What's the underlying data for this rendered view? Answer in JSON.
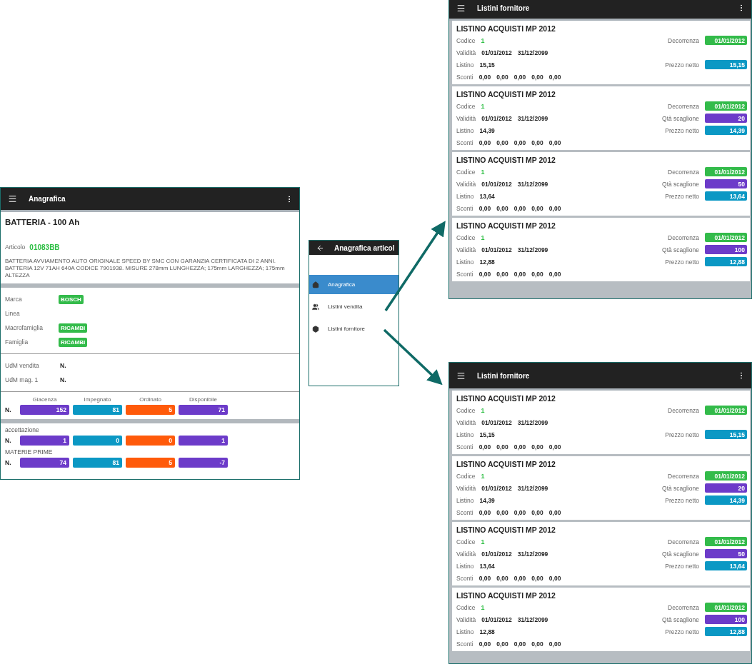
{
  "anagrafica_screen": {
    "title": "Anagrafica",
    "heading": "BATTERIA - 100 Ah",
    "articolo": {
      "label": "Articolo",
      "value": "01083BB"
    },
    "description": "BATTERIA AVVIAMENTO AUTO ORIGINALE SPEED BY SMC CON GARANZIA CERTIFICATA DI 2 ANNI. BATTERIA 12V 71AH 640A CODICE 7901938. MISURE 278mm LUNGHEZZA; 175mm LARGHEZZA; 175mm ALTEZZA",
    "attributes": [
      {
        "label": "Marca",
        "tag": "BOSCH"
      },
      {
        "label": "Linea"
      },
      {
        "label": "Macrofamiglia",
        "tag": "RICAMBI"
      },
      {
        "label": "Famiglia",
        "tag": "RICAMBI"
      }
    ],
    "units": [
      {
        "label": "UdM vendita",
        "value": "N."
      },
      {
        "label": "UdM mag. 1",
        "value": "N."
      }
    ],
    "stock_columns": [
      {
        "label": "Giacenza",
        "color": "#6c3bc9"
      },
      {
        "label": "Impegnato",
        "color": "#0b98c4"
      },
      {
        "label": "Ordinato",
        "color": "#ff5a0a"
      },
      {
        "label": "Disponibile",
        "color": "#6c3bc9"
      }
    ],
    "stock_rows": [
      {
        "unit": "N.",
        "values": [
          "152",
          "81",
          "5",
          "71"
        ]
      },
      {
        "location": "accettazione",
        "unit": "N.",
        "values": [
          "1",
          "0",
          "0",
          "1"
        ]
      },
      {
        "location": "MATERIE PRIME",
        "unit": "N.",
        "values": [
          "74",
          "81",
          "5",
          "-7"
        ]
      }
    ]
  },
  "menu_screen": {
    "title": "Anagrafica articol",
    "items": [
      {
        "label": "Anagrafica",
        "selected": true
      },
      {
        "label": "Listini vendita",
        "selected": false
      },
      {
        "label": "Listini fornitore",
        "selected": false
      }
    ]
  },
  "listini_screens": [
    {
      "title": "Listini fornitore",
      "cards": [
        {
          "title": "LISTINO ACQUISTI MP 2012",
          "codice_label": "Codice",
          "codice": "1",
          "decorrenza_label": "Decorrenza",
          "decorrenza": "01/01/2012",
          "validita_label": "Validità",
          "valid_from": "01/01/2012",
          "valid_to": "31/12/2099",
          "listino_label": "Listino",
          "listino": "15,15",
          "prezzo_label": "Prezzo netto",
          "prezzo": "15,15",
          "sconti_label": "Sconti",
          "sconti": [
            "0,00",
            "0,00",
            "0,00",
            "0,00",
            "0,00"
          ]
        },
        {
          "title": "LISTINO ACQUISTI MP 2012",
          "codice_label": "Codice",
          "codice": "1",
          "decorrenza_label": "Decorrenza",
          "decorrenza": "01/01/2012",
          "validita_label": "Validità",
          "valid_from": "01/01/2012",
          "valid_to": "31/12/2099",
          "scaglione_label": "Qtà scaglione",
          "scaglione": "20",
          "listino_label": "Listino",
          "listino": "14,39",
          "prezzo_label": "Prezzo netto",
          "prezzo": "14,39",
          "sconti_label": "Sconti",
          "sconti": [
            "0,00",
            "0,00",
            "0,00",
            "0,00",
            "0,00"
          ]
        },
        {
          "title": "LISTINO ACQUISTI MP 2012",
          "codice_label": "Codice",
          "codice": "1",
          "decorrenza_label": "Decorrenza",
          "decorrenza": "01/01/2012",
          "validita_label": "Validità",
          "valid_from": "01/01/2012",
          "valid_to": "31/12/2099",
          "scaglione_label": "Qtà scaglione",
          "scaglione": "50",
          "listino_label": "Listino",
          "listino": "13,64",
          "prezzo_label": "Prezzo netto",
          "prezzo": "13,64",
          "sconti_label": "Sconti",
          "sconti": [
            "0,00",
            "0,00",
            "0,00",
            "0,00",
            "0,00"
          ]
        },
        {
          "title": "LISTINO ACQUISTI MP 2012",
          "codice_label": "Codice",
          "codice": "1",
          "decorrenza_label": "Decorrenza",
          "decorrenza": "01/01/2012",
          "validita_label": "Validità",
          "valid_from": "01/01/2012",
          "valid_to": "31/12/2099",
          "scaglione_label": "Qtà scaglione",
          "scaglione": "100",
          "listino_label": "Listino",
          "listino": "12,88",
          "prezzo_label": "Prezzo netto",
          "prezzo": "12,88",
          "sconti_label": "Sconti",
          "sconti": [
            "0,00",
            "0,00",
            "0,00",
            "0,00",
            "0,00"
          ]
        }
      ]
    },
    {
      "title": "Listini fornitore",
      "cards": [
        {
          "title": "LISTINO ACQUISTI MP 2012",
          "codice_label": "Codice",
          "codice": "1",
          "decorrenza_label": "Decorrenza",
          "decorrenza": "01/01/2012",
          "validita_label": "Validità",
          "valid_from": "01/01/2012",
          "valid_to": "31/12/2099",
          "listino_label": "Listino",
          "listino": "15,15",
          "prezzo_label": "Prezzo netto",
          "prezzo": "15,15",
          "sconti_label": "Sconti",
          "sconti": [
            "0,00",
            "0,00",
            "0,00",
            "0,00",
            "0,00"
          ]
        },
        {
          "title": "LISTINO ACQUISTI MP 2012",
          "codice_label": "Codice",
          "codice": "1",
          "decorrenza_label": "Decorrenza",
          "decorrenza": "01/01/2012",
          "validita_label": "Validità",
          "valid_from": "01/01/2012",
          "valid_to": "31/12/2099",
          "scaglione_label": "Qtà scaglione",
          "scaglione": "20",
          "listino_label": "Listino",
          "listino": "14,39",
          "prezzo_label": "Prezzo netto",
          "prezzo": "14,39",
          "sconti_label": "Sconti",
          "sconti": [
            "0,00",
            "0,00",
            "0,00",
            "0,00",
            "0,00"
          ]
        },
        {
          "title": "LISTINO ACQUISTI MP 2012",
          "codice_label": "Codice",
          "codice": "1",
          "decorrenza_label": "Decorrenza",
          "decorrenza": "01/01/2012",
          "validita_label": "Validità",
          "valid_from": "01/01/2012",
          "valid_to": "31/12/2099",
          "scaglione_label": "Qtà scaglione",
          "scaglione": "50",
          "listino_label": "Listino",
          "listino": "13,64",
          "prezzo_label": "Prezzo netto",
          "prezzo": "13,64",
          "sconti_label": "Sconti",
          "sconti": [
            "0,00",
            "0,00",
            "0,00",
            "0,00",
            "0,00"
          ]
        },
        {
          "title": "LISTINO ACQUISTI MP 2012",
          "codice_label": "Codice",
          "codice": "1",
          "decorrenza_label": "Decorrenza",
          "decorrenza": "01/01/2012",
          "validita_label": "Validità",
          "valid_from": "01/01/2012",
          "valid_to": "31/12/2099",
          "scaglione_label": "Qtà scaglione",
          "scaglione": "100",
          "listino_label": "Listino",
          "listino": "12,88",
          "prezzo_label": "Prezzo netto",
          "prezzo": "12,88",
          "sconti_label": "Sconti",
          "sconti": [
            "0,00",
            "0,00",
            "0,00",
            "0,00",
            "0,00"
          ]
        }
      ]
    }
  ]
}
